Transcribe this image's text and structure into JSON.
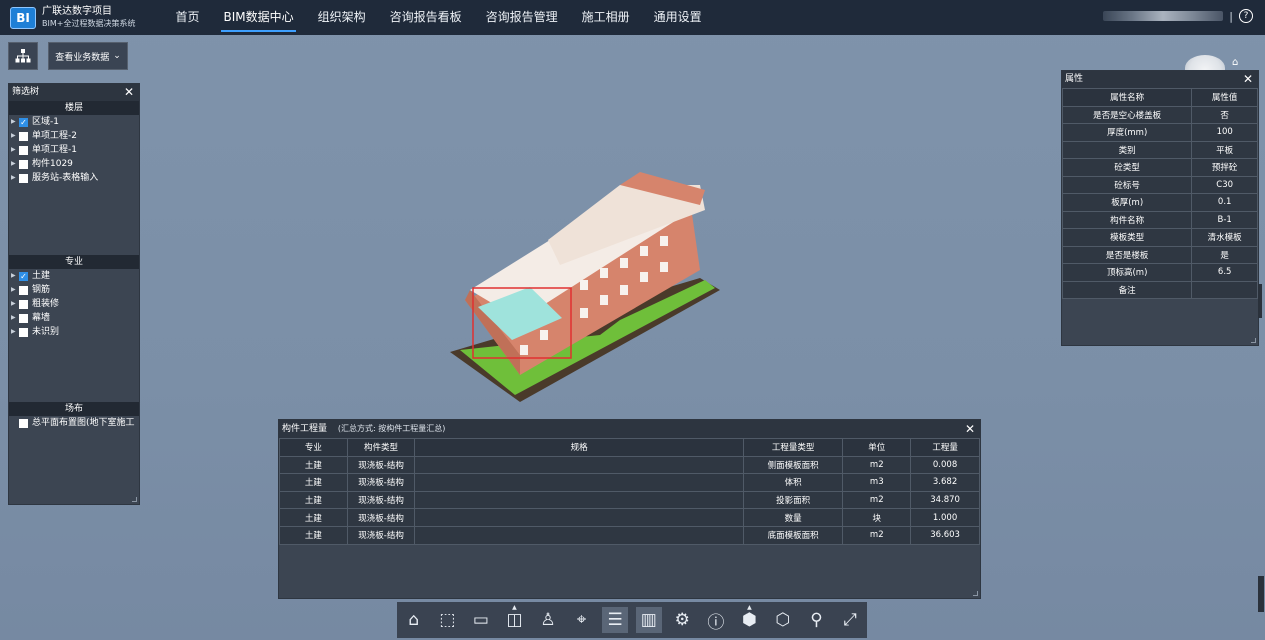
{
  "app": {
    "logo_text": "BI",
    "name_line1": "广联达数字项目",
    "name_line2": "BIM+全过程数据决策系统"
  },
  "nav": [
    {
      "label": "首页",
      "active": false
    },
    {
      "label": "BIM数据中心",
      "active": true
    },
    {
      "label": "组织架构",
      "active": false
    },
    {
      "label": "咨询报告看板",
      "active": false
    },
    {
      "label": "咨询报告管理",
      "active": false
    },
    {
      "label": "施工相册",
      "active": false
    },
    {
      "label": "通用设置",
      "active": false
    }
  ],
  "user": {
    "separator": "|",
    "help_icon": "question-circle-icon"
  },
  "toolbar": {
    "tree_icon": "org-tree-icon",
    "biz_label": "查看业务数据",
    "biz_chevron": "⌄"
  },
  "filter_panel": {
    "title": "筛选树",
    "close": "✕",
    "floor_section": "楼层",
    "floor_items": [
      {
        "label": "区域-1",
        "checked": true
      },
      {
        "label": "单项工程-2",
        "checked": false
      },
      {
        "label": "单项工程-1",
        "checked": false
      },
      {
        "label": "构件1029",
        "checked": false
      },
      {
        "label": "服务站-表格输入",
        "checked": false
      }
    ],
    "major_section": "专业",
    "major_items": [
      {
        "label": "土建",
        "checked": true
      },
      {
        "label": "钢筋",
        "checked": false
      },
      {
        "label": "粗装修",
        "checked": false
      },
      {
        "label": "幕墙",
        "checked": false
      },
      {
        "label": "未识别",
        "checked": false
      }
    ],
    "site_section": "场布",
    "site_items": [
      {
        "label": "总平面布置图(地下室施工",
        "checked": false
      }
    ]
  },
  "properties": {
    "title": "属性",
    "close": "✕",
    "col_name": "属性名称",
    "col_value": "属性值",
    "rows": [
      [
        "是否是空心楼盖板",
        "否"
      ],
      [
        "厚度(mm)",
        "100"
      ],
      [
        "类别",
        "平板"
      ],
      [
        "砼类型",
        "预拌砼"
      ],
      [
        "砼标号",
        "C30"
      ],
      [
        "板厚(m)",
        "0.1"
      ],
      [
        "构件名称",
        "B-1"
      ],
      [
        "模板类型",
        "清水模板"
      ],
      [
        "是否是楼板",
        "是"
      ],
      [
        "顶标高(m)",
        "6.5"
      ],
      [
        "备注",
        ""
      ]
    ]
  },
  "quantity": {
    "title": "构件工程量",
    "subtitle": "(汇总方式: 按构件工程量汇总)",
    "close": "✕",
    "headers": [
      "专业",
      "构件类型",
      "规格",
      "工程量类型",
      "单位",
      "工程量"
    ],
    "rows": [
      [
        "土建",
        "现浇板-结构",
        "",
        "侧面模板面积",
        "m2",
        "0.008"
      ],
      [
        "土建",
        "现浇板-结构",
        "",
        "体积",
        "m3",
        "3.682"
      ],
      [
        "土建",
        "现浇板-结构",
        "",
        "投影面积",
        "m2",
        "34.870"
      ],
      [
        "土建",
        "现浇板-结构",
        "",
        "数量",
        "块",
        "1.000"
      ],
      [
        "土建",
        "现浇板-结构",
        "",
        "底面模板面积",
        "m2",
        "36.603"
      ]
    ]
  },
  "bottom_tools": [
    {
      "name": "home-icon",
      "glyph": "⌂",
      "active": false
    },
    {
      "name": "zoom-box-icon",
      "glyph": "⬚",
      "active": false
    },
    {
      "name": "measure-icon",
      "glyph": "▭",
      "active": false
    },
    {
      "name": "section-icon",
      "glyph": "◫",
      "active": false,
      "caret": true
    },
    {
      "name": "walk-person-icon",
      "glyph": "♙",
      "active": false
    },
    {
      "name": "location-pin-icon",
      "glyph": "⌖",
      "active": false
    },
    {
      "name": "list-icon",
      "glyph": "☰",
      "active": true
    },
    {
      "name": "bar-chart-icon",
      "glyph": "▥",
      "active": true
    },
    {
      "name": "settings-gear-icon",
      "glyph": "⚙",
      "active": false
    },
    {
      "name": "info-icon",
      "glyph": "ⓘ",
      "active": false
    },
    {
      "name": "cube-view-icon",
      "glyph": "⬢",
      "active": false,
      "caret": true
    },
    {
      "name": "model-box-icon",
      "glyph": "⬡",
      "active": false
    },
    {
      "name": "map-pin-person-icon",
      "glyph": "⚲",
      "active": false
    },
    {
      "name": "fullscreen-icon",
      "glyph": "⤢",
      "active": false
    }
  ],
  "colors": {
    "topbar": "#1f2a3a",
    "viewport_bg": "#7f93ab",
    "panel_bg": "#3c4552",
    "accent": "#3ea0ff",
    "checkbox_on": "#2f8fe6",
    "selection_box": "#e03030"
  }
}
